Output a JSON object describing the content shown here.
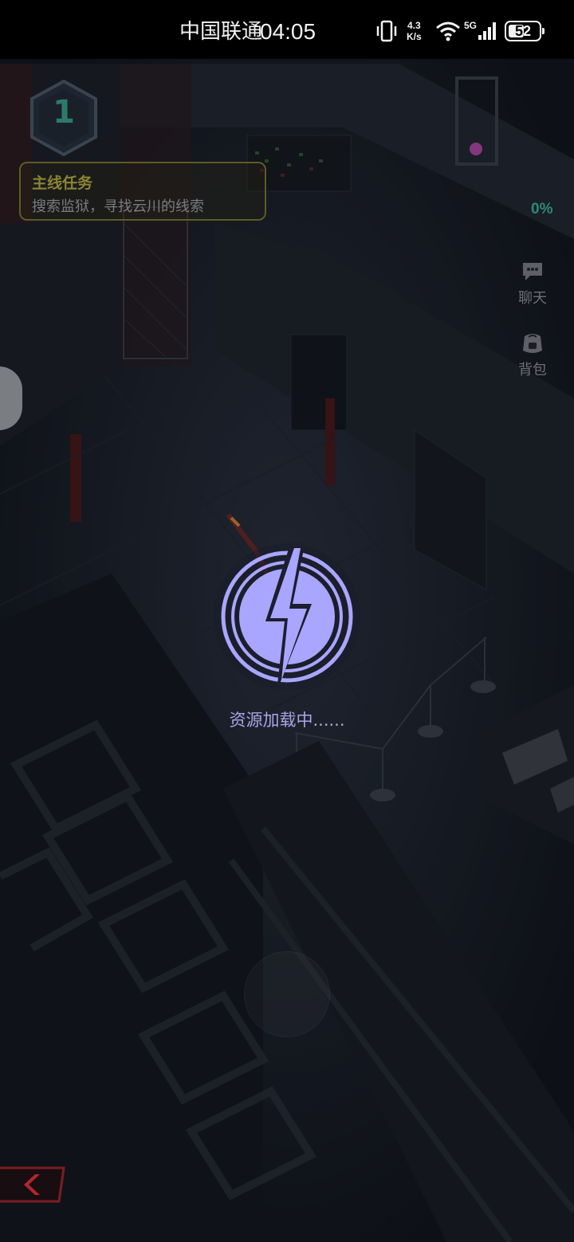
{
  "status_bar": {
    "carrier": "中国联通",
    "time": "04:05",
    "network_speed_value": "4.3",
    "network_speed_unit": "K/s",
    "network_type": "5G",
    "battery_level": "52",
    "icons": [
      "vibrate-icon",
      "wifi-icon",
      "cellular-signal-icon",
      "battery-icon"
    ]
  },
  "hud": {
    "level": "1",
    "quest": {
      "title": "主线任务",
      "description": "搜索监狱，寻找云川的线索"
    },
    "progress": "0%",
    "side_menu": [
      {
        "label": "聊天",
        "icon": "chat-icon"
      },
      {
        "label": "背包",
        "icon": "backpack-icon"
      }
    ]
  },
  "loader": {
    "icon": "lightning-bolt-icon",
    "text": "资源加载中......"
  },
  "colors": {
    "loader_accent": "#a9a6ff",
    "quest_title": "#8b8434",
    "progress": "#2b8a78",
    "back_button": "#b3262e"
  }
}
